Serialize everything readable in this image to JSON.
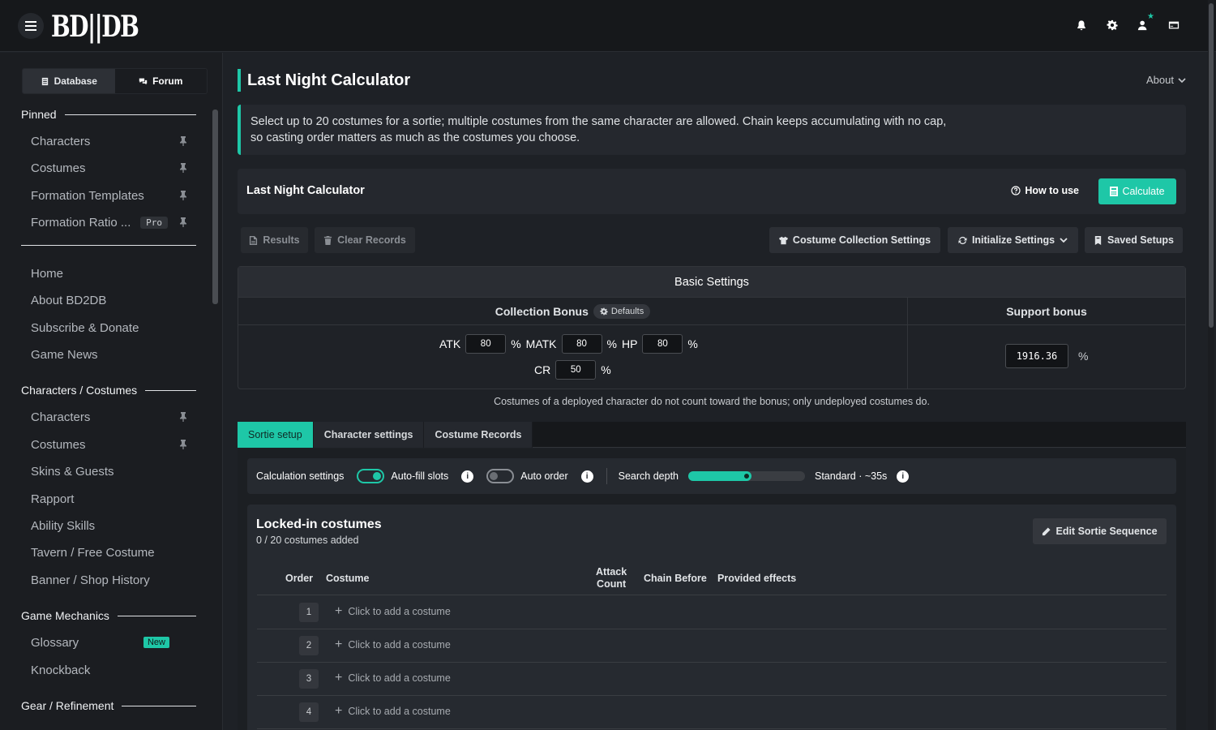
{
  "app": {
    "logo": "BD||DB"
  },
  "sidebar": {
    "tabs": [
      {
        "label": "Database"
      },
      {
        "label": "Forum"
      }
    ],
    "sections": {
      "pinned": "Pinned",
      "characters_costumes": "Characters / Costumes",
      "game_mechanics": "Game Mechanics",
      "gear_refinement": "Gear / Refinement"
    },
    "pinned_items": [
      {
        "label": "Characters"
      },
      {
        "label": "Costumes"
      },
      {
        "label": "Formation Templates"
      },
      {
        "label": "Formation Ratio ...",
        "badge": "Pro"
      }
    ],
    "general_items": [
      {
        "label": "Home"
      },
      {
        "label": "About BD2DB"
      },
      {
        "label": "Subscribe & Donate"
      },
      {
        "label": "Game News"
      }
    ],
    "character_items": [
      {
        "label": "Characters"
      },
      {
        "label": "Costumes"
      },
      {
        "label": "Skins & Guests"
      },
      {
        "label": "Rapport"
      },
      {
        "label": "Ability Skills"
      },
      {
        "label": "Tavern / Free Costume"
      },
      {
        "label": "Banner / Shop History"
      }
    ],
    "mechanics_items": [
      {
        "label": "Glossary",
        "badge": "New"
      },
      {
        "label": "Knockback"
      }
    ]
  },
  "header": {
    "page_title": "Last Night Calculator",
    "about_label": "About"
  },
  "notice": {
    "line1": "Select up to 20 costumes for a sortie; multiple costumes from the same character are allowed. Chain keeps accumulating with no cap,",
    "line2": "so casting order matters as much as the costumes you choose."
  },
  "calc_card": {
    "title": "Last Night Calculator",
    "how_to_use": "How to use",
    "calculate": "Calculate"
  },
  "toolbar": {
    "results": "Results",
    "clear_records": "Clear Records",
    "costume_collection_settings": "Costume Collection Settings",
    "initialize_settings": "Initialize Settings",
    "saved_setups": "Saved Setups"
  },
  "basic_settings": {
    "title": "Basic Settings",
    "collection_bonus": "Collection Bonus",
    "defaults": "Defaults",
    "support_bonus": "Support bonus",
    "atk_label": "ATK",
    "atk_value": "80",
    "matk_label": "MATK",
    "matk_value": "80",
    "hp_label": "HP",
    "hp_value": "80",
    "cr_label": "CR",
    "cr_value": "50",
    "percent": "%",
    "support_value": "1916.36",
    "note": "Costumes of a deployed character do not count toward the bonus; only undeployed costumes do."
  },
  "tabs": [
    {
      "label": "Sortie setup"
    },
    {
      "label": "Character settings"
    },
    {
      "label": "Costume Records"
    }
  ],
  "calc_settings": {
    "label": "Calculation settings",
    "auto_fill": "Auto-fill slots",
    "auto_fill_on": true,
    "auto_order": "Auto order",
    "auto_order_on": false,
    "search_depth": "Search depth",
    "search_depth_level": 0.5,
    "search_depth_value": "Standard · ~35s",
    "info_glyph": "i"
  },
  "locked": {
    "title": "Locked-in costumes",
    "subtitle": "0 / 20 costumes added",
    "edit_button": "Edit Sortie Sequence",
    "columns": {
      "order": "Order",
      "costume": "Costume",
      "attack_count_1": "Attack",
      "attack_count_2": "Count",
      "chain_before": "Chain Before",
      "provided_effects": "Provided effects"
    },
    "rows": [
      {
        "order": "1",
        "text": "Click to add a costume"
      },
      {
        "order": "2",
        "text": "Click to add a costume"
      },
      {
        "order": "3",
        "text": "Click to add a costume"
      },
      {
        "order": "4",
        "text": "Click to add a costume"
      }
    ]
  },
  "colors": {
    "accent": "#1ec7a7",
    "background": "#1e2126",
    "panel": "#25282e"
  }
}
